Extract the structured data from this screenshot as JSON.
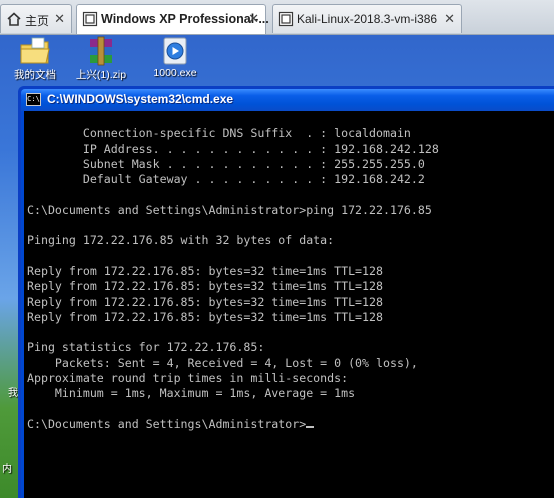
{
  "tabs": [
    {
      "label": "主页",
      "icon": "home-icon"
    },
    {
      "label": "Windows XP Professional-...",
      "icon": "vm-icon"
    },
    {
      "label": "Kali-Linux-2018.3-vm-i386",
      "icon": "vm-icon"
    }
  ],
  "desktop": {
    "icons": [
      {
        "label": "我的文档",
        "icon": "folder-icon"
      },
      {
        "label": "上兴(1).zip",
        "icon": "zip-archive-icon"
      },
      {
        "label": "1000.exe",
        "icon": "media-player-icon"
      }
    ],
    "edge_labels": [
      "我",
      "内"
    ]
  },
  "cmd": {
    "title": "C:\\WINDOWS\\system32\\cmd.exe",
    "lines": [
      "",
      "        Connection-specific DNS Suffix  . : localdomain",
      "        IP Address. . . . . . . . . . . . : 192.168.242.128",
      "        Subnet Mask . . . . . . . . . . . : 255.255.255.0",
      "        Default Gateway . . . . . . . . . : 192.168.242.2",
      "",
      "C:\\Documents and Settings\\Administrator>ping 172.22.176.85",
      "",
      "Pinging 172.22.176.85 with 32 bytes of data:",
      "",
      "Reply from 172.22.176.85: bytes=32 time=1ms TTL=128",
      "Reply from 172.22.176.85: bytes=32 time=1ms TTL=128",
      "Reply from 172.22.176.85: bytes=32 time=1ms TTL=128",
      "Reply from 172.22.176.85: bytes=32 time=1ms TTL=128",
      "",
      "Ping statistics for 172.22.176.85:",
      "    Packets: Sent = 4, Received = 4, Lost = 0 (0% loss),",
      "Approximate round trip times in milli-seconds:",
      "    Minimum = 1ms, Maximum = 1ms, Average = 1ms",
      "",
      "C:\\Documents and Settings\\Administrator>"
    ]
  }
}
